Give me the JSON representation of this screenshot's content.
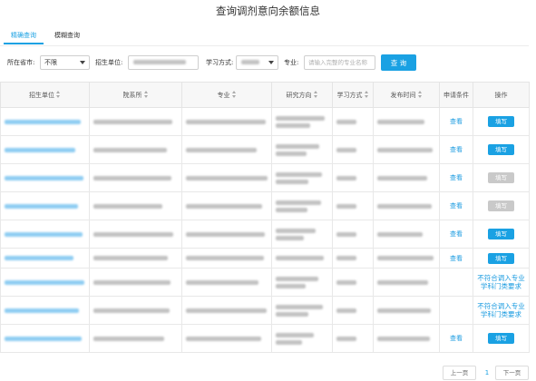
{
  "page": {
    "title": "查询调剂意向余额信息"
  },
  "tabs": [
    {
      "label": "精确查询",
      "active": true
    },
    {
      "label": "模糊查询",
      "active": false
    }
  ],
  "filters": {
    "province_label": "所在省市:",
    "province_value": "不限",
    "unit_label": "招生单位:",
    "study_mode_label": "学习方式:",
    "major_label": "专业:",
    "major_placeholder": "请输入完整的专业名称",
    "search_button": "查 询"
  },
  "table": {
    "columns": [
      {
        "label": "招生单位",
        "sortable": true
      },
      {
        "label": "院系所",
        "sortable": true
      },
      {
        "label": "专业",
        "sortable": true
      },
      {
        "label": "研究方向",
        "sortable": true
      },
      {
        "label": "学习方式",
        "sortable": true
      },
      {
        "label": "发布时间",
        "sortable": true
      },
      {
        "label": "申请条件",
        "sortable": false
      },
      {
        "label": "操作",
        "sortable": false
      }
    ],
    "rows": [
      {
        "apply_conditions": "查看",
        "action": {
          "button": "填写",
          "enabled": true
        }
      },
      {
        "apply_conditions": "查看",
        "action": {
          "button": "填写",
          "enabled": true
        }
      },
      {
        "apply_conditions": "查看",
        "action": {
          "button": "填写",
          "enabled": false
        }
      },
      {
        "apply_conditions": "查看",
        "action": {
          "button": "填写",
          "enabled": false
        }
      },
      {
        "apply_conditions": "查看",
        "action": {
          "button": "填写",
          "enabled": true
        }
      },
      {
        "apply_conditions": "查看",
        "action": {
          "button": "填写",
          "enabled": true
        }
      },
      {
        "apply_conditions": null,
        "action": {
          "notice": "不符合调入专业学科门类要求"
        }
      },
      {
        "apply_conditions": null,
        "action": {
          "notice": "不符合调入专业学科门类要求"
        }
      },
      {
        "apply_conditions": "查看",
        "action": {
          "button": "填写",
          "enabled": true
        }
      }
    ]
  },
  "pagination": {
    "prev": "上一页",
    "current": "1",
    "next": "下一页"
  },
  "colors": {
    "accent": "#1aa1e3",
    "link": "#1a9be0",
    "disabled": "#c9c9c9"
  },
  "icons": {
    "sort": "sort-arrows-icon",
    "dropdown": "chevron-down-icon"
  }
}
